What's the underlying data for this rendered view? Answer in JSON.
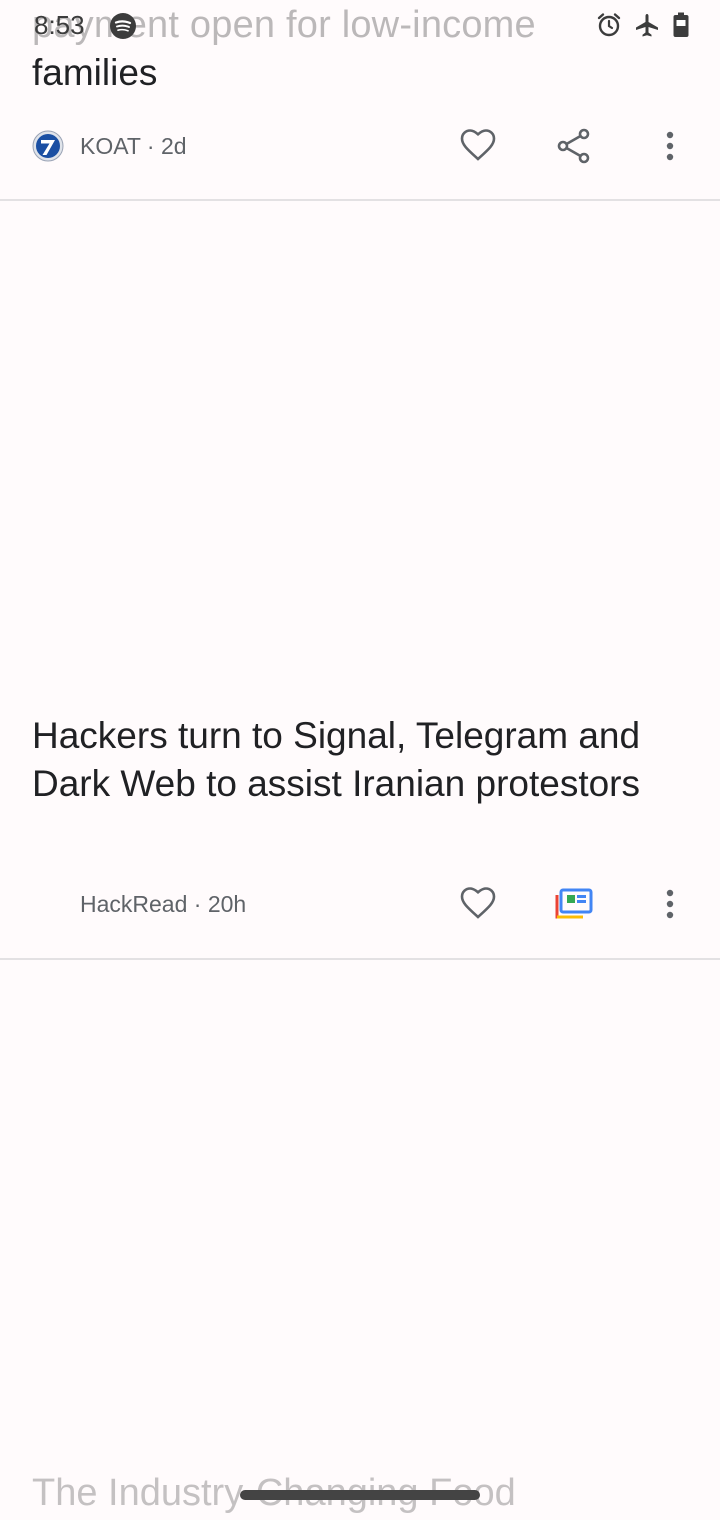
{
  "status_bar": {
    "time": "8:53",
    "left_icons": [
      "spotify-icon"
    ],
    "right_icons": [
      "alarm-icon",
      "airplane-mode-icon",
      "battery-icon"
    ]
  },
  "article1": {
    "headline_faded_fragment": "payment open for low-income",
    "headline_end": "families",
    "source": "KOAT",
    "age": "2d",
    "source_line": "KOAT · 2d",
    "actions": [
      "heart-icon",
      "share-icon",
      "more-options-icon"
    ]
  },
  "article2": {
    "headline": "Hackers turn to Signal, Telegram and Dark Web to assist Iranian protestors",
    "source": "HackRead",
    "age": "20h",
    "source_line": "HackRead · 20h",
    "actions": [
      "heart-icon",
      "full-coverage-icon",
      "more-options-icon"
    ]
  },
  "article3": {
    "headline_faded_fragment": "The Industry-Changing Food"
  },
  "colors": {
    "background": "#fffbfc",
    "text_primary": "#202124",
    "text_secondary": "#5f6368",
    "divider": "#e3e1e3",
    "koat_logo_blue": "#1a4fa3"
  }
}
